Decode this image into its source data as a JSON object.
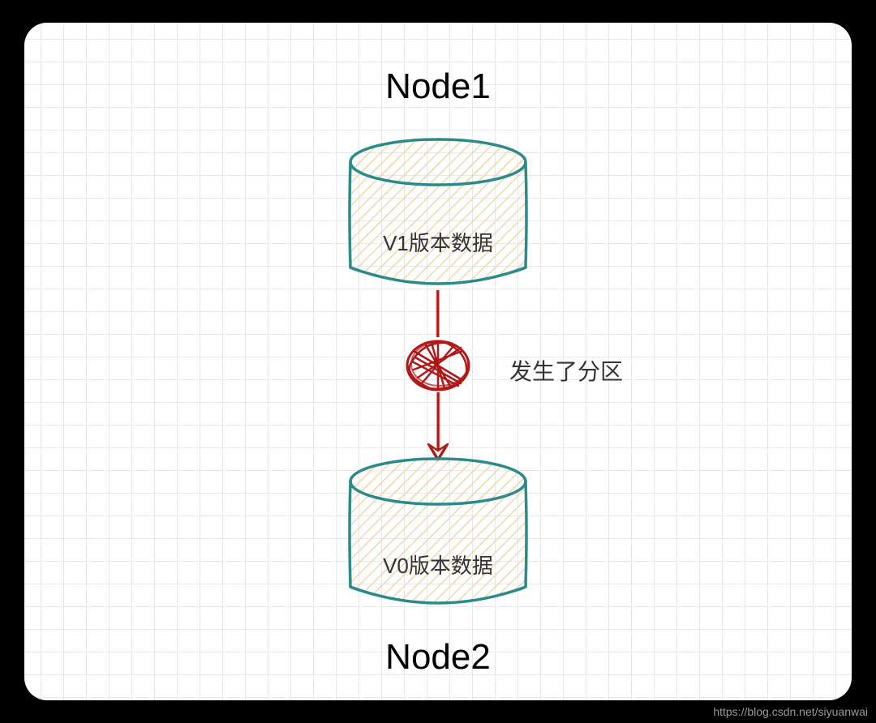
{
  "diagram": {
    "node1_title": "Node1",
    "node2_title": "Node2",
    "cylinder1_label": "V1版本数据",
    "cylinder2_label": "V0版本数据",
    "partition_label": "发生了分区"
  },
  "watermark": "https://blog.csdn.net/siyuanwai",
  "colors": {
    "cylinder_stroke": "#2b8a8a",
    "cylinder_fill_hatch": "#f0d9a8",
    "arrow_color": "#b01818",
    "grid_color": "#e8e8ea"
  }
}
